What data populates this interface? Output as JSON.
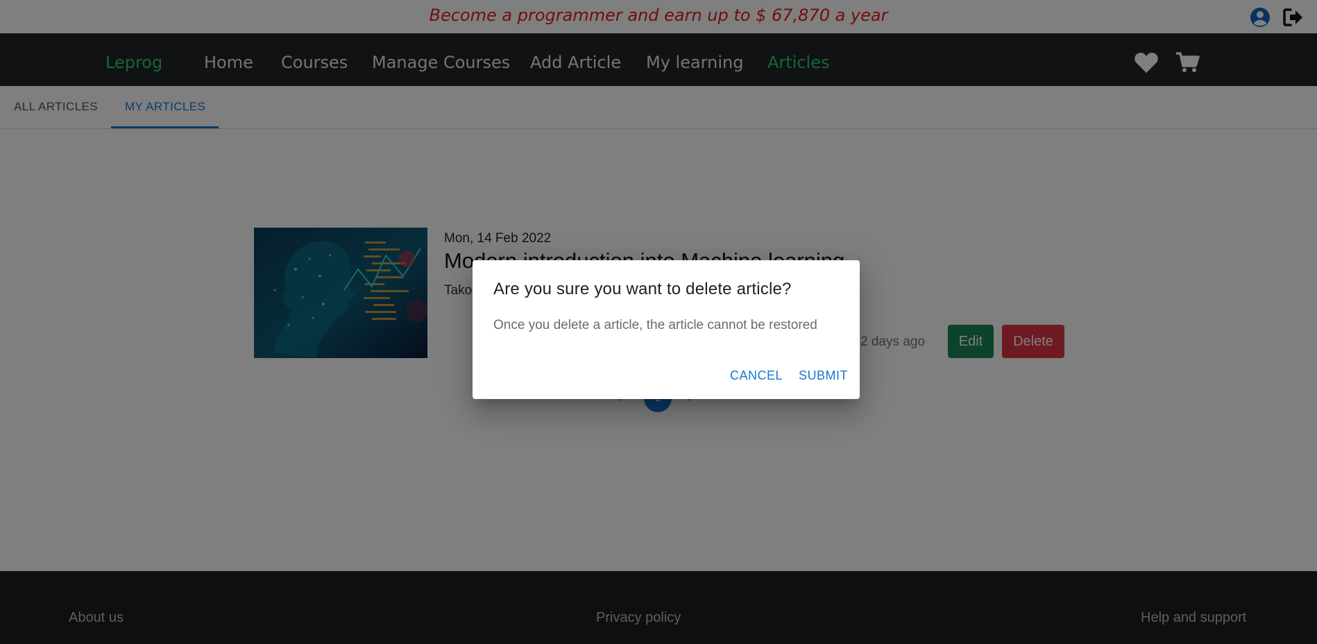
{
  "promo": {
    "text": "Become a programmer and earn up to $ 67,870 a year"
  },
  "colors": {
    "accent": "#1976d2",
    "brand_green": "#2ecc71",
    "promo_red": "#e41a1a",
    "edit": "#198754",
    "delete": "#dc3545"
  },
  "top_icons": [
    "user-circle-icon",
    "logout-icon"
  ],
  "navbar": {
    "brand": "Leprog",
    "items": [
      "Home",
      "Courses",
      "Manage Courses",
      "Add Article",
      "My learning",
      "Articles"
    ],
    "active": "Articles",
    "icons": [
      "heart-icon",
      "cart-icon"
    ]
  },
  "tabs": {
    "items": [
      "ALL ARTICLES",
      "MY ARTICLES"
    ],
    "active": "MY ARTICLES"
  },
  "article": {
    "date": "Mon, 14 Feb 2022",
    "title": "Modern introduction into Machine learning",
    "author": "Tako",
    "ago": "2 days ago",
    "edit_label": "Edit",
    "delete_label": "Delete"
  },
  "pagination": {
    "prev": "‹",
    "current": "1",
    "next": "›"
  },
  "footer": {
    "about": "About us",
    "privacy": "Privacy policy",
    "help": "Help and support"
  },
  "dialog": {
    "title": "Are you sure you want to delete article?",
    "text": "Once you delete a article, the article cannot be restored",
    "cancel_label": "CANCEL",
    "submit_label": "SUBMIT"
  }
}
